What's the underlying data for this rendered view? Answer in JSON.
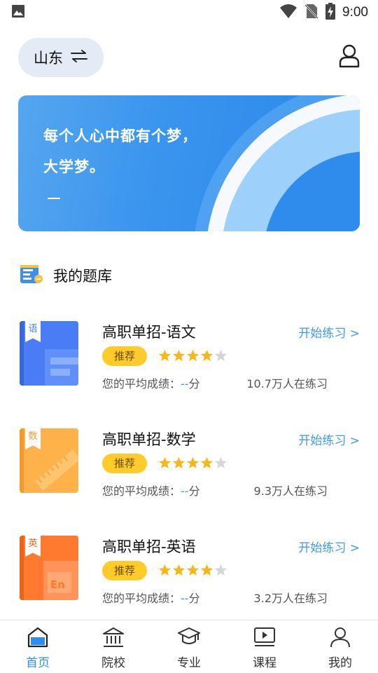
{
  "status_bar": {
    "time": "9:00"
  },
  "header": {
    "region": "山东"
  },
  "banner": {
    "line1": "每个人心中都有个梦，",
    "line2": "大学梦。",
    "dash": "—"
  },
  "section": {
    "title": "我的题库"
  },
  "courses": [
    {
      "title": "高职单招-语文",
      "tag": "语",
      "start": "开始练习 >",
      "badge": "推荐",
      "rating": 4,
      "score_label": "您的平均成绩：",
      "score_value": "--",
      "score_unit": "分",
      "count": "10.7万人在练习",
      "color": "#4a7df5"
    },
    {
      "title": "高职单招-数学",
      "tag": "数",
      "start": "开始练习 >",
      "badge": "推荐",
      "rating": 4,
      "score_label": "您的平均成绩：",
      "score_value": "--",
      "score_unit": "分",
      "count": "9.3万人在练习",
      "color": "#ffb14a"
    },
    {
      "title": "高职单招-英语",
      "tag": "英",
      "start": "开始练习 >",
      "badge": "推荐",
      "rating": 4,
      "score_label": "您的平均成绩：",
      "score_value": "--",
      "score_unit": "分",
      "count": "3.2万人在练习",
      "color": "#ff7a2f"
    }
  ],
  "nav": {
    "items": [
      {
        "label": "首页",
        "icon": "home-icon",
        "active": true
      },
      {
        "label": "院校",
        "icon": "school-icon",
        "active": false
      },
      {
        "label": "专业",
        "icon": "graduation-cap-icon",
        "active": false
      },
      {
        "label": "课程",
        "icon": "video-course-icon",
        "active": false
      },
      {
        "label": "我的",
        "icon": "user-icon",
        "active": false
      }
    ]
  },
  "colors": {
    "accent": "#2f8df0",
    "link": "#3d9be9",
    "badge": "#ffcb2b",
    "star": "#f5b71a",
    "star_empty": "#d6d6d6"
  }
}
